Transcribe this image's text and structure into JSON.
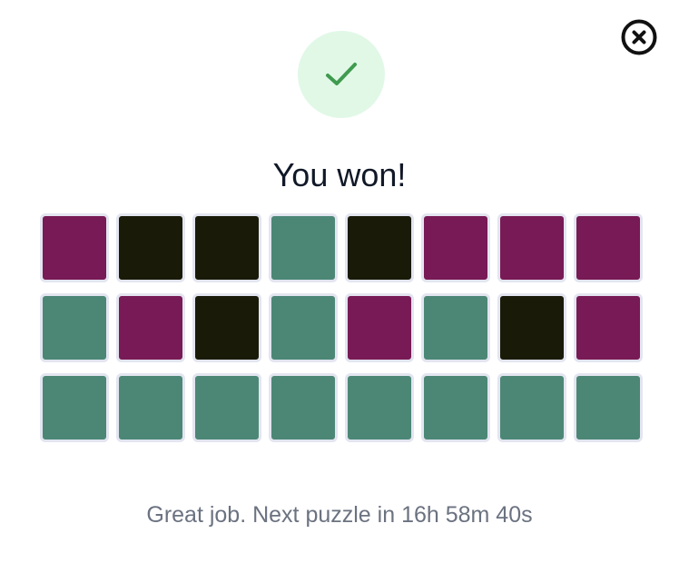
{
  "modal": {
    "title": "You won!",
    "message": "Great job. Next puzzle in 16h 58m 40s",
    "close_icon": "close-circle-icon",
    "success_icon": "checkmark-icon"
  },
  "colors": {
    "purple": "#781a55",
    "black": "#191a08",
    "green": "#4c8776",
    "success_bg": "#e1f8e7",
    "success_check": "#3f9b4f"
  },
  "result_grid": {
    "rows": [
      [
        "purple",
        "black",
        "black",
        "green",
        "black",
        "purple",
        "purple",
        "purple"
      ],
      [
        "green",
        "purple",
        "black",
        "green",
        "purple",
        "green",
        "black",
        "purple"
      ],
      [
        "green",
        "green",
        "green",
        "green",
        "green",
        "green",
        "green",
        "green"
      ]
    ]
  }
}
